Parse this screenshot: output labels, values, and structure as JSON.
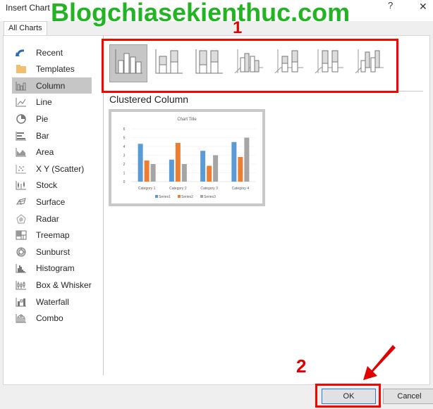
{
  "window": {
    "title": "Insert Chart",
    "help_label": "?",
    "close_label": "✕",
    "watermark": "Blogchiasekienthuc.com"
  },
  "tabs": [
    {
      "label": "All Charts",
      "active": true
    }
  ],
  "sidebar": {
    "items": [
      {
        "label": "Recent",
        "icon": "recent-icon"
      },
      {
        "label": "Templates",
        "icon": "folder-icon"
      },
      {
        "label": "Column",
        "icon": "column-chart-icon",
        "active": true
      },
      {
        "label": "Line",
        "icon": "line-chart-icon"
      },
      {
        "label": "Pie",
        "icon": "pie-chart-icon"
      },
      {
        "label": "Bar",
        "icon": "bar-chart-icon"
      },
      {
        "label": "Area",
        "icon": "area-chart-icon"
      },
      {
        "label": "X Y (Scatter)",
        "icon": "scatter-chart-icon"
      },
      {
        "label": "Stock",
        "icon": "stock-chart-icon"
      },
      {
        "label": "Surface",
        "icon": "surface-chart-icon"
      },
      {
        "label": "Radar",
        "icon": "radar-chart-icon"
      },
      {
        "label": "Treemap",
        "icon": "treemap-chart-icon"
      },
      {
        "label": "Sunburst",
        "icon": "sunburst-chart-icon"
      },
      {
        "label": "Histogram",
        "icon": "histogram-chart-icon"
      },
      {
        "label": "Box & Whisker",
        "icon": "box-whisker-chart-icon"
      },
      {
        "label": "Waterfall",
        "icon": "waterfall-chart-icon"
      },
      {
        "label": "Combo",
        "icon": "combo-chart-icon"
      }
    ]
  },
  "subtypes": [
    {
      "name": "clustered-column",
      "active": true
    },
    {
      "name": "stacked-column"
    },
    {
      "name": "100-stacked-column"
    },
    {
      "name": "3d-clustered-column"
    },
    {
      "name": "3d-stacked-column"
    },
    {
      "name": "3d-100-stacked-column"
    },
    {
      "name": "3d-column"
    }
  ],
  "annotations": {
    "step1": "1",
    "step2": "2"
  },
  "selected_subtype_label": "Clustered Column",
  "preview": {
    "chart_data": {
      "type": "bar",
      "title": "Chart Title",
      "categories": [
        "Category 1",
        "Category 2",
        "Category 3",
        "Category 4"
      ],
      "series": [
        {
          "name": "Series1",
          "values": [
            4.3,
            2.5,
            3.5,
            4.5
          ],
          "color": "#5b9bd5"
        },
        {
          "name": "Series2",
          "values": [
            2.4,
            4.4,
            1.8,
            2.8
          ],
          "color": "#ed7d31"
        },
        {
          "name": "Series3",
          "values": [
            2,
            2,
            3,
            5
          ],
          "color": "#a5a5a5"
        }
      ],
      "yticks": [
        "0",
        "1",
        "2",
        "3",
        "4",
        "5",
        "6"
      ],
      "ylim": [
        0,
        6
      ],
      "grid": true,
      "legend": "bottom"
    }
  },
  "buttons": {
    "ok": "OK",
    "cancel": "Cancel"
  }
}
